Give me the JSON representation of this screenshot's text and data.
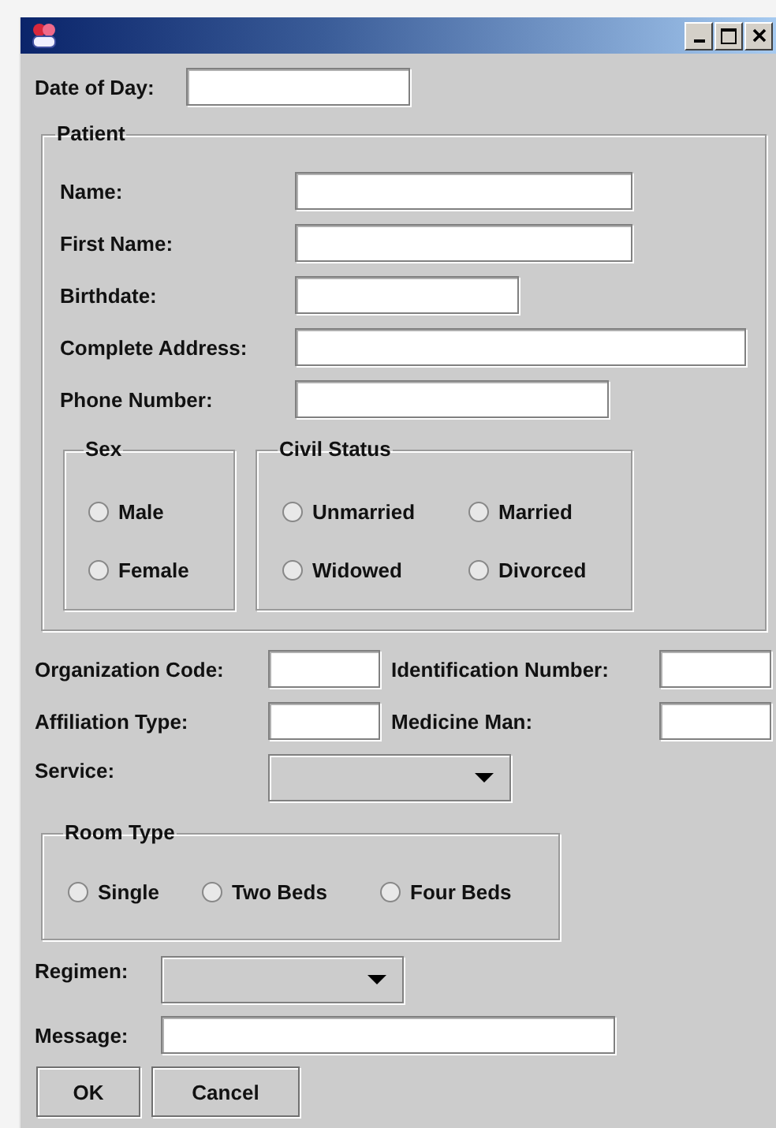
{
  "date_of_day": {
    "label": "Date of Day:"
  },
  "patient": {
    "legend": "Patient",
    "fields": [
      {
        "label": "Name:"
      },
      {
        "label": "First Name:"
      },
      {
        "label": "Birthdate:"
      },
      {
        "label": "Complete Address:"
      },
      {
        "label": "Phone Number:"
      }
    ],
    "sex": {
      "legend": "Sex",
      "options": [
        {
          "label": "Male",
          "selected": false
        },
        {
          "label": "Female",
          "selected": false
        }
      ]
    },
    "civil_status": {
      "legend": "Civil Status",
      "options": [
        {
          "label": "Unmarried",
          "selected": false
        },
        {
          "label": "Married",
          "selected": false
        },
        {
          "label": "Widowed",
          "selected": false
        },
        {
          "label": "Divorced",
          "selected": false
        }
      ]
    }
  },
  "admin_fields": [
    {
      "label": "Organization Code:"
    },
    {
      "label": "Identification Number:"
    },
    {
      "label": "Affiliation Type:"
    },
    {
      "label": "Medicine Man:"
    }
  ],
  "service": {
    "label": "Service:"
  },
  "room_type": {
    "legend": "Room Type",
    "options": [
      {
        "label": "Single",
        "selected": false
      },
      {
        "label": "Two Beds",
        "selected": false
      },
      {
        "label": "Four Beds",
        "selected": false
      }
    ]
  },
  "regimen": {
    "label": "Regimen:"
  },
  "message": {
    "label": "Message:"
  },
  "buttons": [
    {
      "label": "OK"
    },
    {
      "label": "Cancel"
    }
  ]
}
